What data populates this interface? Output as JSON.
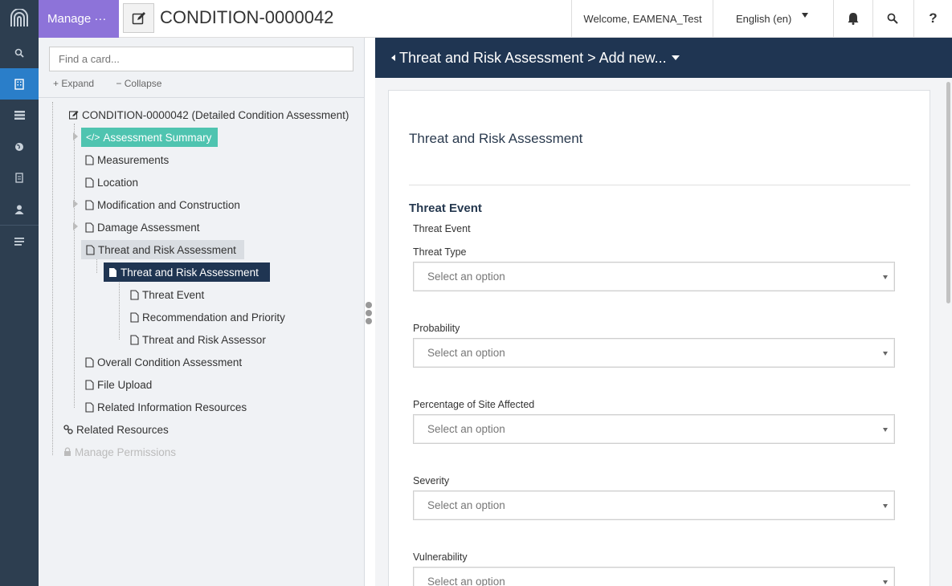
{
  "nav": {
    "items": [
      "search-icon",
      "building-icon",
      "list-icon",
      "globe-icon",
      "bookmark-icon",
      "user-icon",
      "menu-icon"
    ]
  },
  "header": {
    "manage_label": "Manage ···",
    "title": "CONDITION-0000042",
    "welcome": "Welcome, EAMENA_Test",
    "language": "English (en)",
    "help_label": "?"
  },
  "tree": {
    "search_placeholder": "Find a card...",
    "expand_label": "Expand",
    "collapse_label": "Collapse",
    "root": "CONDITION-0000042 (Detailed Condition Assessment)",
    "items": [
      "Assessment Summary",
      "Measurements",
      "Location",
      "Modification and Construction",
      "Damage Assessment",
      "Threat and Risk Assessment",
      "Threat and Risk Assessment",
      "Threat Event",
      "Recommendation and Priority",
      "Threat and Risk Assessor",
      "Overall Condition Assessment",
      "File Upload",
      "Related Information Resources"
    ],
    "related_resources": "Related Resources",
    "manage_permissions": "Manage Permissions"
  },
  "content": {
    "breadcrumb": "Threat and Risk Assessment > Add new...",
    "card_title": "Threat and Risk Assessment",
    "section_title": "Threat Event",
    "sub_label": "Threat Event",
    "fields": [
      {
        "label": "Threat Type",
        "value": "Select an option"
      },
      {
        "label": "Probability",
        "value": "Select an option"
      },
      {
        "label": "Percentage of Site Affected",
        "value": "Select an option"
      },
      {
        "label": "Severity",
        "value": "Select an option"
      },
      {
        "label": "Vulnerability",
        "value": "Select an option"
      }
    ]
  },
  "colors": {
    "nav_bg": "#2d3e50",
    "nav_active": "#2a7ec9",
    "manage_purple": "#8d73d9",
    "summary_teal": "#4fc4b0",
    "selected_navy": "#1f3552"
  }
}
